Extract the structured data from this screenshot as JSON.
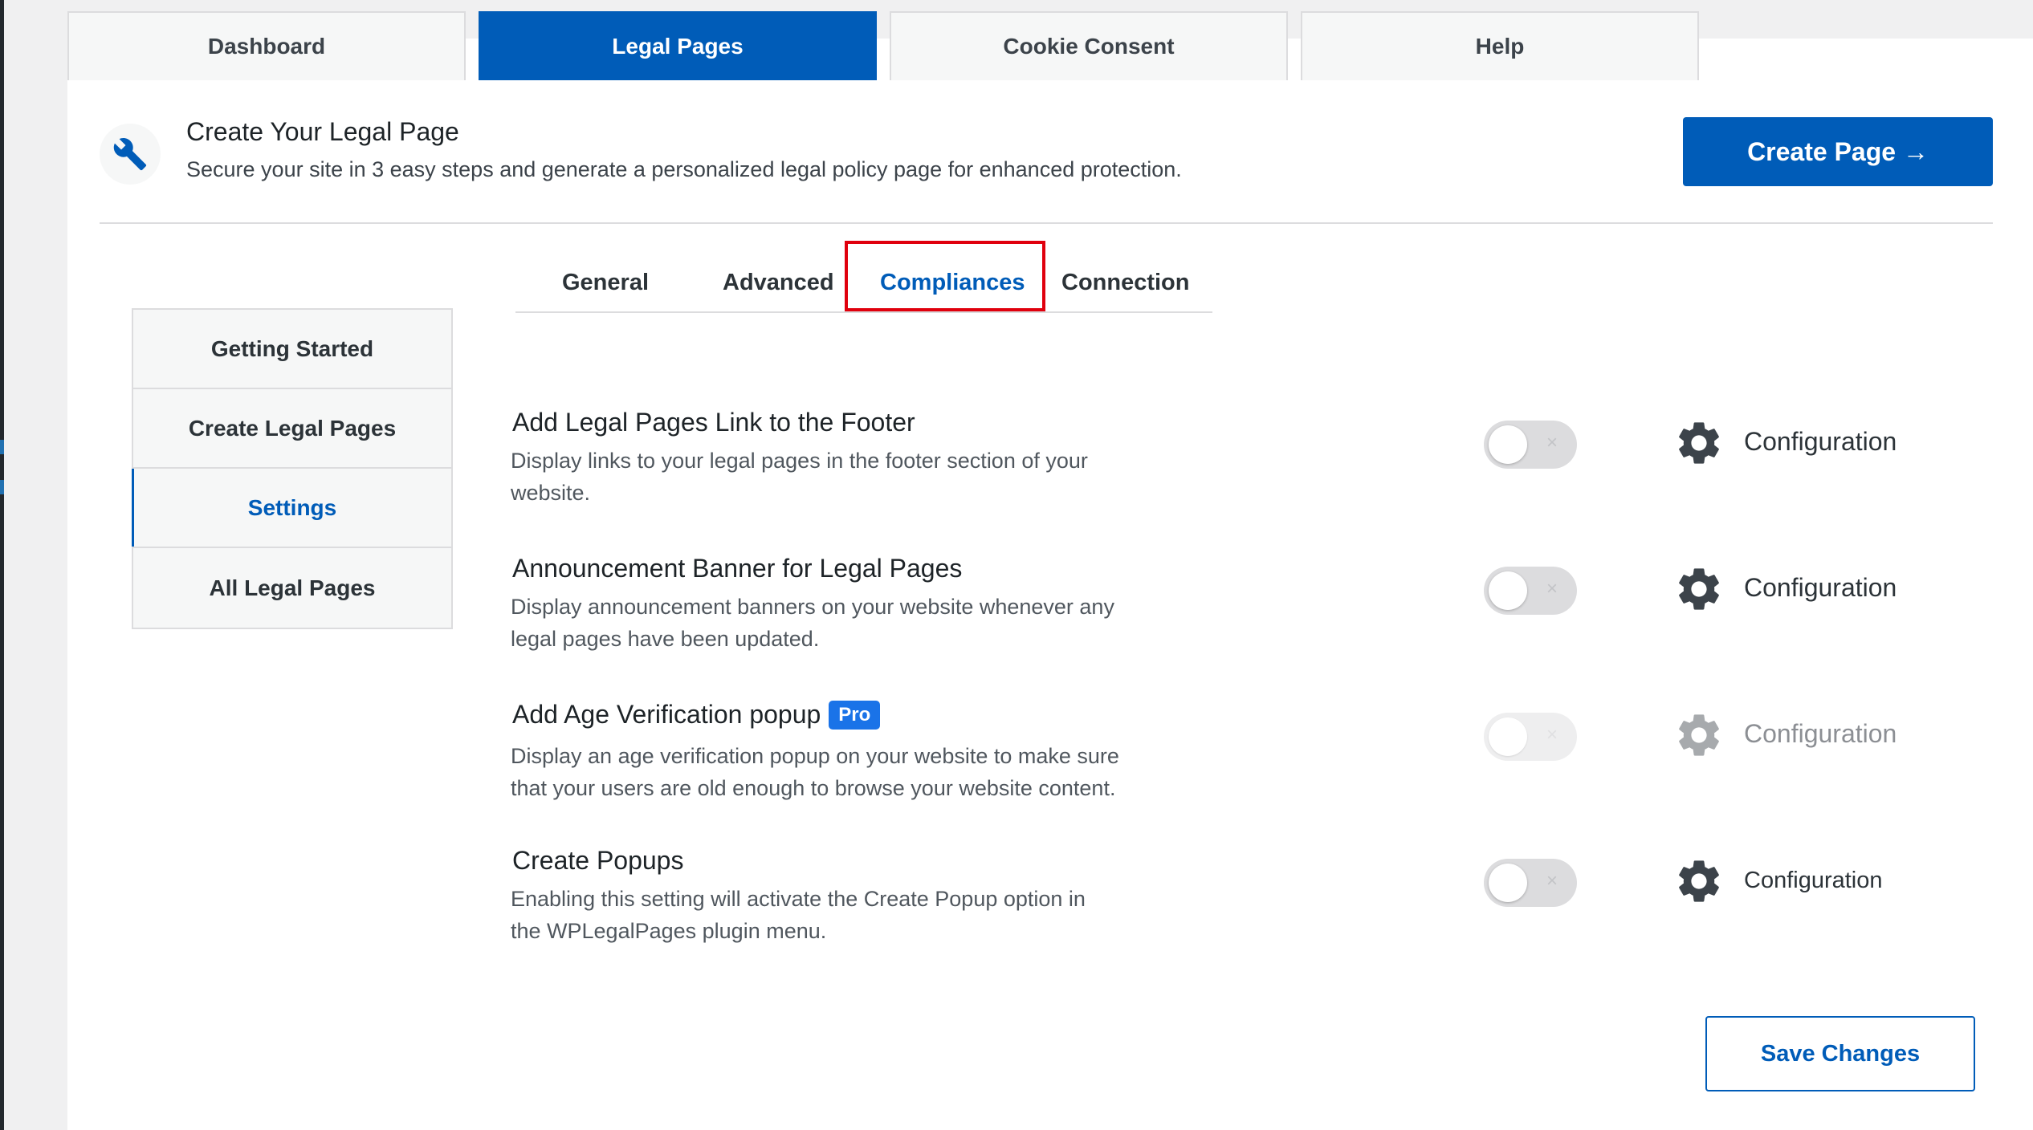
{
  "top_tabs": [
    {
      "label": "Dashboard",
      "active": false
    },
    {
      "label": "Legal Pages",
      "active": true
    },
    {
      "label": "Cookie Consent",
      "active": false
    },
    {
      "label": "Help",
      "active": false
    }
  ],
  "hero": {
    "icon": "wrench-icon",
    "title": "Create Your Legal Page",
    "subtitle": "Secure your site in 3 easy steps and generate a personalized legal policy page for enhanced protection.",
    "create_button": "Create Page →"
  },
  "side_menu": [
    {
      "label": "Getting Started",
      "active": false
    },
    {
      "label": "Create Legal Pages",
      "active": false
    },
    {
      "label": "Settings",
      "active": true
    },
    {
      "label": "All Legal Pages",
      "active": false
    }
  ],
  "sub_tabs": [
    {
      "label": "General",
      "active": false
    },
    {
      "label": "Advanced",
      "active": false
    },
    {
      "label": "Compliances",
      "active": true
    },
    {
      "label": "Connection",
      "active": false
    }
  ],
  "settings": [
    {
      "title": "Add Legal Pages Link to the Footer",
      "description": "Display links to your legal pages in the footer section of your website.",
      "enabled": false,
      "disabled": false,
      "config_label": "Configuration",
      "badge": ""
    },
    {
      "title": "Announcement Banner for Legal Pages",
      "description": "Display announcement banners on your website whenever any legal pages have been updated.",
      "enabled": false,
      "disabled": false,
      "config_label": "Configuration",
      "badge": ""
    },
    {
      "title": "Add Age Verification popup",
      "description": "Display an age verification popup on your website to make sure that your users are old enough to browse your website content.",
      "enabled": false,
      "disabled": true,
      "config_label": "Configuration",
      "badge": "Pro"
    },
    {
      "title": "Create Popups",
      "description": "Enabling this setting will activate the Create Popup option in the WPLegalPages plugin menu.",
      "enabled": false,
      "disabled": false,
      "config_label": "Configuration",
      "badge": ""
    }
  ],
  "toggle_off_symbol": "×",
  "save_button": "Save Changes",
  "colors": {
    "brand_blue": "#005cb8",
    "highlight_red": "#e0000d",
    "pro_badge": "#1a73e8",
    "gear": "#3c434a",
    "gear_disabled": "#a7aaad"
  }
}
